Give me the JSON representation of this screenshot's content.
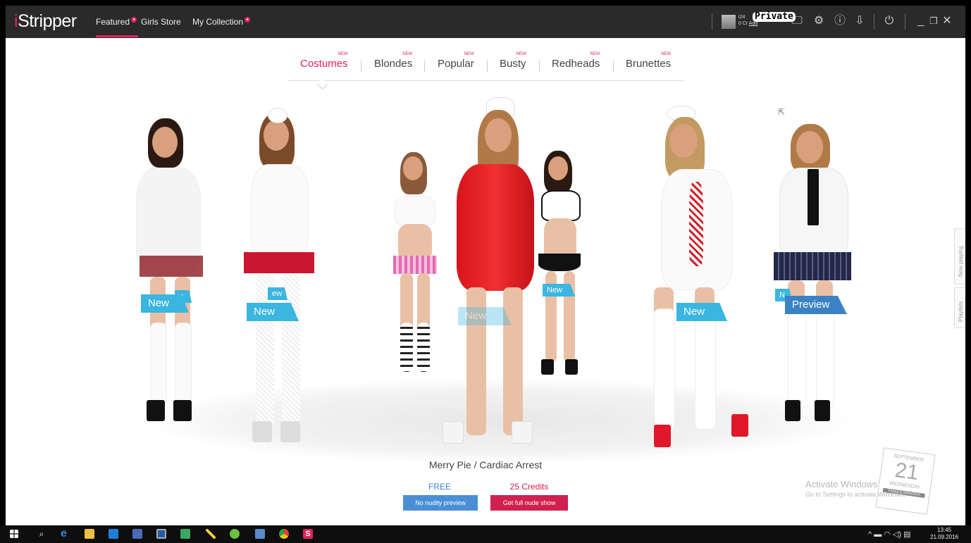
{
  "app": {
    "logo_i": "i",
    "logo_rest": "Stripper"
  },
  "nav": {
    "items": [
      {
        "label": "Featured",
        "badge": "●"
      },
      {
        "label": "Girls Store"
      },
      {
        "label": "My Collection",
        "badge": "●"
      }
    ]
  },
  "account": {
    "line1": "i24",
    "line2": "0 Cr",
    "add": "Add",
    "overlay": "Private"
  },
  "toolbar_icons": [
    "monitor-icon",
    "settings-icon",
    "info-icon",
    "download-icon",
    "power-icon",
    "minimize-icon",
    "restore-icon",
    "close-icon"
  ],
  "toolbar_glyphs": {
    "monitor": "🖵",
    "settings": "⚙",
    "info": "ⓘ",
    "download": "⇩",
    "power": "⏻",
    "minimize": "_",
    "restore": "❐",
    "close": "✕"
  },
  "categories": [
    {
      "label": "Costumes",
      "new": "NEW",
      "active": true
    },
    {
      "label": "Blondes",
      "new": "NEW"
    },
    {
      "label": "Popular",
      "new": "NEW"
    },
    {
      "label": "Busty",
      "new": "NEW"
    },
    {
      "label": "Redheads",
      "new": "NEW"
    },
    {
      "label": "Brunettes",
      "new": "NEW"
    }
  ],
  "tags": {
    "t1": "New",
    "t2": "New",
    "t3": "New",
    "t4": "New",
    "t5": "New",
    "t6": "New",
    "t7": "Preview",
    "t1b": "v",
    "t2b": "ew",
    "t6b": "N"
  },
  "show": {
    "title": "Merry Pie / Cardiac Arrest",
    "free_label": "FREE",
    "credits_label": "25 Credits",
    "preview_button": "No nudity preview",
    "full_button": "Get full nude show"
  },
  "side_tabs": {
    "now_playing": "Now playing",
    "playlists": "Playlists"
  },
  "watermark": {
    "line1": "Activate Windows",
    "line2": "Go to Settings to activate Windows."
  },
  "calendar": {
    "month": "SEPTEMBER",
    "day": "21",
    "weekday": "WEDNESDAY",
    "sub": "Today's Selection"
  },
  "taskbar": {
    "time": "13:45",
    "date": "21.09.2016",
    "tray": "^ ▬ ◠ ◁) ▤"
  },
  "colors": {
    "accent": "#e0245a",
    "tag": "#3ab6e0",
    "topbar": "#2a2a2a",
    "free": "#3b86d4",
    "credits": "#d0204f"
  }
}
